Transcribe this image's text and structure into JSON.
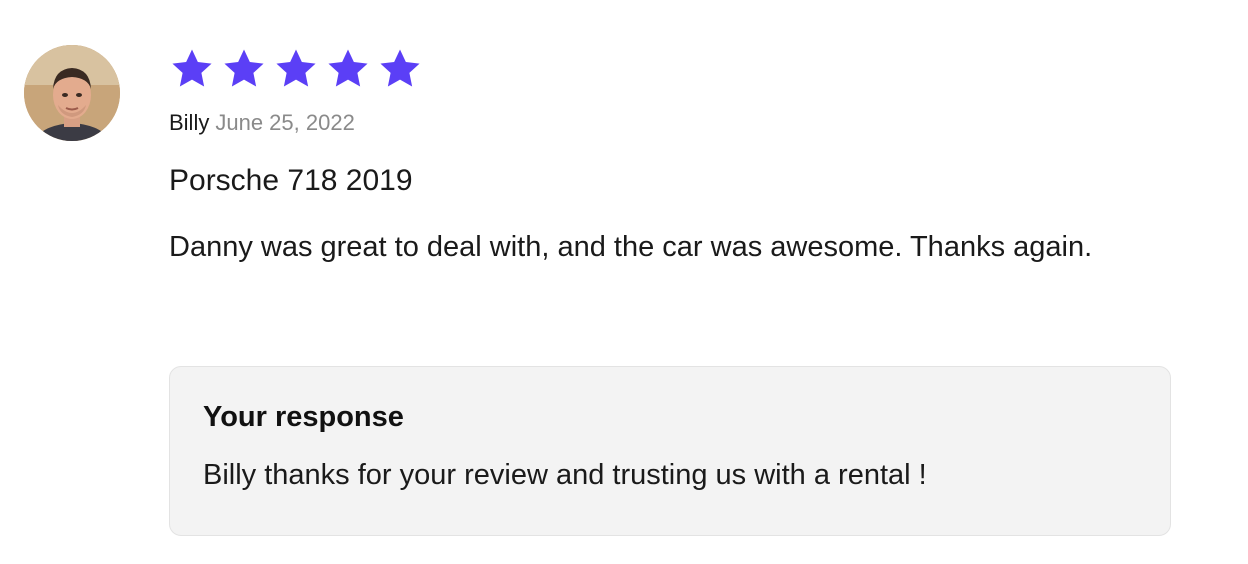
{
  "review": {
    "rating": 5,
    "max_rating": 5,
    "star_color": "#5b3ff6",
    "reviewer_name": "Billy",
    "date": "June 25, 2022",
    "vehicle": "Porsche 718 2019",
    "text": "Danny was great to deal with, and the car was awesome. Thanks again."
  },
  "response": {
    "title": "Your response",
    "text": "Billy thanks for your review and trusting us with a rental !"
  }
}
